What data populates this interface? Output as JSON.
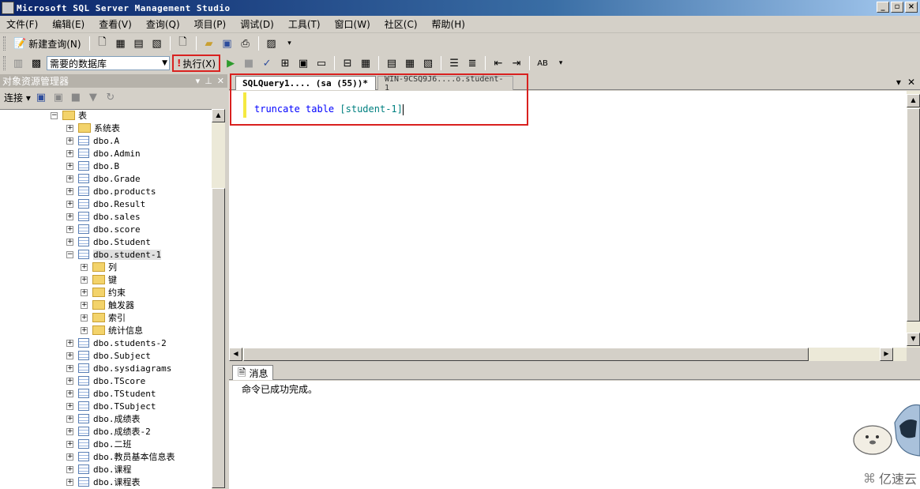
{
  "window": {
    "title": "Microsoft SQL Server Management Studio"
  },
  "menu": [
    "文件(F)",
    "编辑(E)",
    "查看(V)",
    "查询(Q)",
    "项目(P)",
    "调试(D)",
    "工具(T)",
    "窗口(W)",
    "社区(C)",
    "帮助(H)"
  ],
  "toolbar": {
    "new_query": "新建查询(N)",
    "database": "需要的数据库",
    "execute": "执行(X)"
  },
  "explorer": {
    "title": "对象资源管理器",
    "connect": "连接",
    "tables_folder": "表",
    "system_tables": "系统表",
    "tables_before": [
      "dbo.A",
      "dbo.Admin",
      "dbo.B",
      "dbo.Grade",
      "dbo.products",
      "dbo.Result",
      "dbo.sales",
      "dbo.score",
      "dbo.Student"
    ],
    "selected_table": "dbo.student-1",
    "subfolders": [
      "列",
      "键",
      "约束",
      "触发器",
      "索引",
      "统计信息"
    ],
    "tables_after": [
      "dbo.students-2",
      "dbo.Subject",
      "dbo.sysdiagrams",
      "dbo.TScore",
      "dbo.TStudent",
      "dbo.TSubject",
      "dbo.成绩表",
      "dbo.成绩表-2",
      "dbo.二班",
      "dbo.教员基本信息表",
      "dbo.课程",
      "dbo.课程表"
    ]
  },
  "tabs": {
    "active": "SQLQuery1.... (sa (55))*",
    "inactive": "WIN-9CSQ9J6....o.student-1"
  },
  "editor": {
    "kw1": "truncate",
    "kw2": "table",
    "ident": "[student-1]"
  },
  "messages": {
    "tab": "消息",
    "text": "命令已成功完成。"
  },
  "watermark": "亿速云",
  "colors": {
    "highlight": "#d9211f",
    "keyword": "#0000ff",
    "identifier": "#008080"
  }
}
